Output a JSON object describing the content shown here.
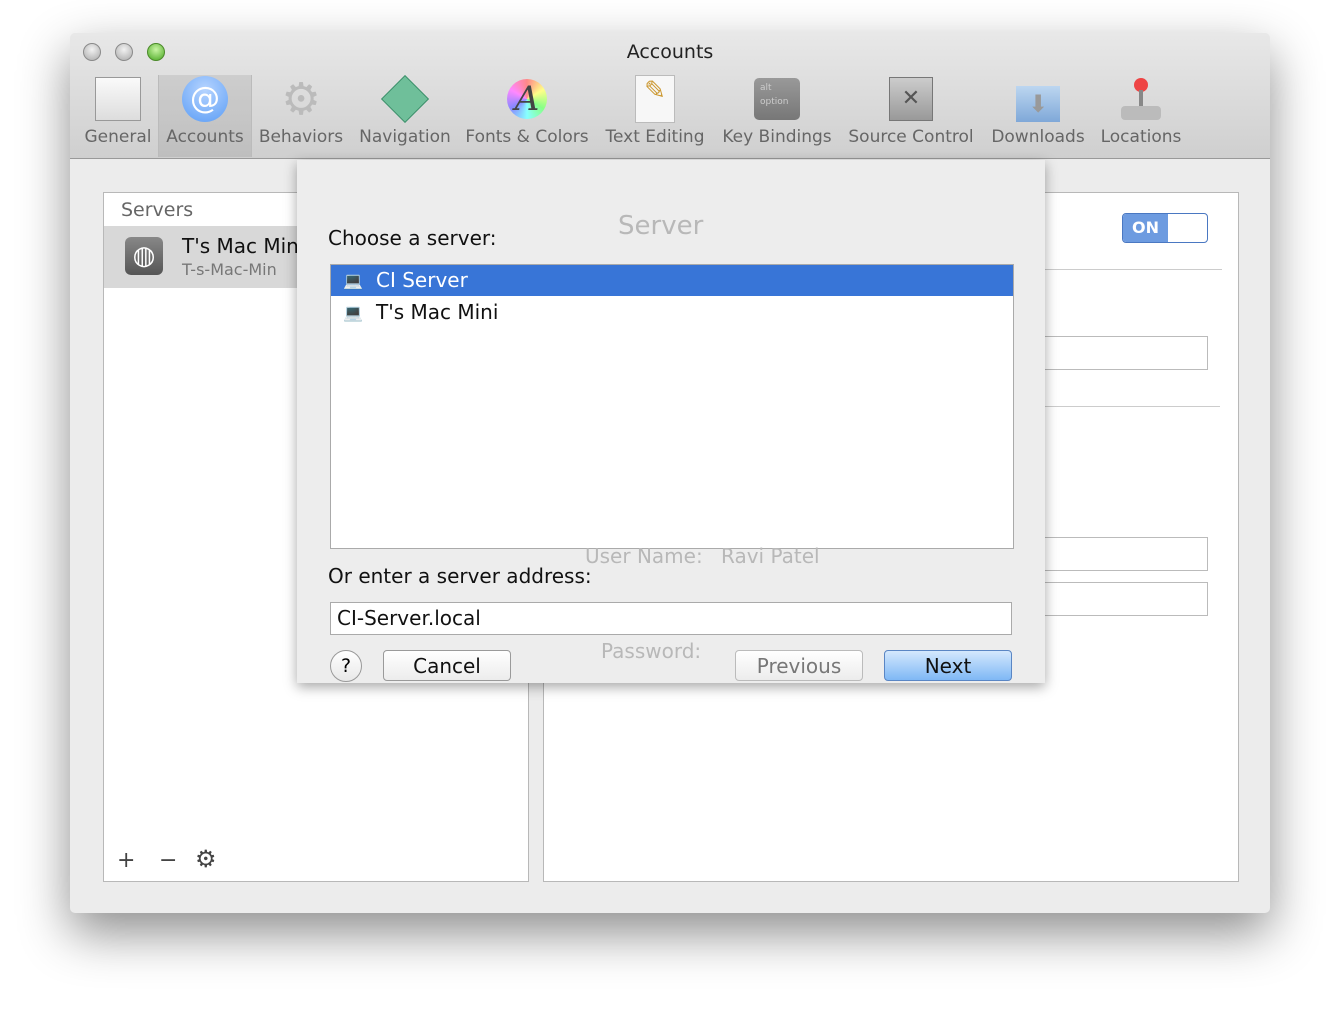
{
  "window": {
    "title": "Accounts"
  },
  "toolbar": [
    {
      "label": "General",
      "icon": "light-switch-icon"
    },
    {
      "label": "Accounts",
      "icon": "at-sign-icon"
    },
    {
      "label": "Behaviors",
      "icon": "gear-icon"
    },
    {
      "label": "Navigation",
      "icon": "arrows-diamond-icon"
    },
    {
      "label": "Fonts & Colors",
      "icon": "font-color-icon"
    },
    {
      "label": "Text Editing",
      "icon": "pencil-paper-icon"
    },
    {
      "label": "Key Bindings",
      "icon": "keyboard-key-icon",
      "key_top": "alt",
      "key_bottom": "option"
    },
    {
      "label": "Source Control",
      "icon": "safe-icon"
    },
    {
      "label": "Downloads",
      "icon": "download-box-icon"
    },
    {
      "label": "Locations",
      "icon": "joystick-icon"
    }
  ],
  "servers": {
    "header": "Servers",
    "items": [
      {
        "name": "T's Mac Min",
        "host": "T-s-Mac-Min"
      }
    ]
  },
  "detail": {
    "toggle": "ON",
    "ghost_title": "Server",
    "ghost_user_label": "User Name:",
    "ghost_user": "Ravi Patel",
    "ghost_password_label": "Password:",
    "ghost_password": "••••••••••••••••"
  },
  "sheet": {
    "choose_label": "Choose a server:",
    "servers": [
      "CI Server",
      "T's Mac Mini"
    ],
    "address_label": "Or enter a server address:",
    "address_value": "CI-Server.local",
    "help": "?",
    "cancel": "Cancel",
    "previous": "Previous",
    "next": "Next"
  },
  "colors": {
    "selection": "#3875d7",
    "accent": "#6ea3e8"
  }
}
